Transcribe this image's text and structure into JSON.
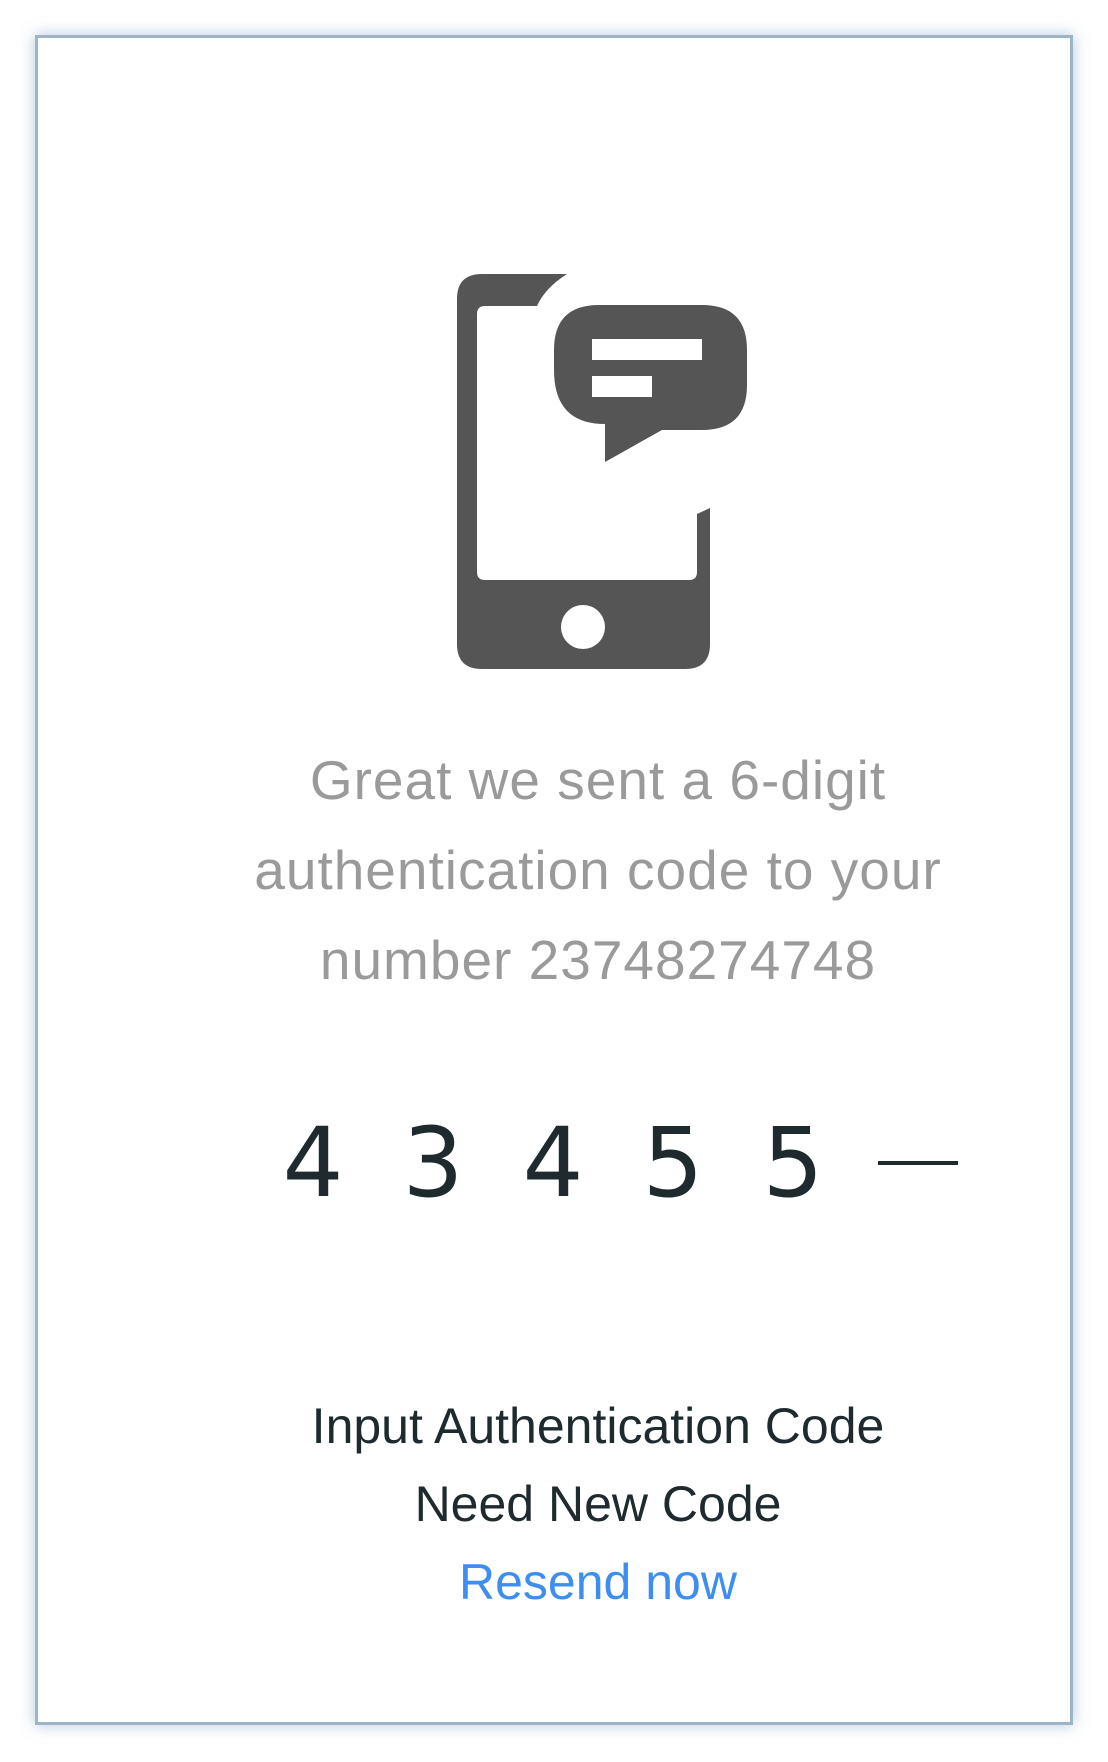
{
  "message": {
    "line1": "Great we sent a 6-digit",
    "line2": "authentication code to your",
    "line3": "number 23748274748"
  },
  "code": {
    "digits": [
      "4",
      "3",
      "4",
      "5",
      "5",
      ""
    ]
  },
  "labels": {
    "instruction": "Input Authentication Code",
    "need_new_code": "Need New Code",
    "resend": "Resend now"
  },
  "colors": {
    "icon": "#555555",
    "message_text": "#9a9a9a",
    "primary_text": "#1e2a2d",
    "link": "#3d8ef0",
    "card_border": "#9db5c8"
  },
  "icons": {
    "main": "phone-message-icon"
  }
}
